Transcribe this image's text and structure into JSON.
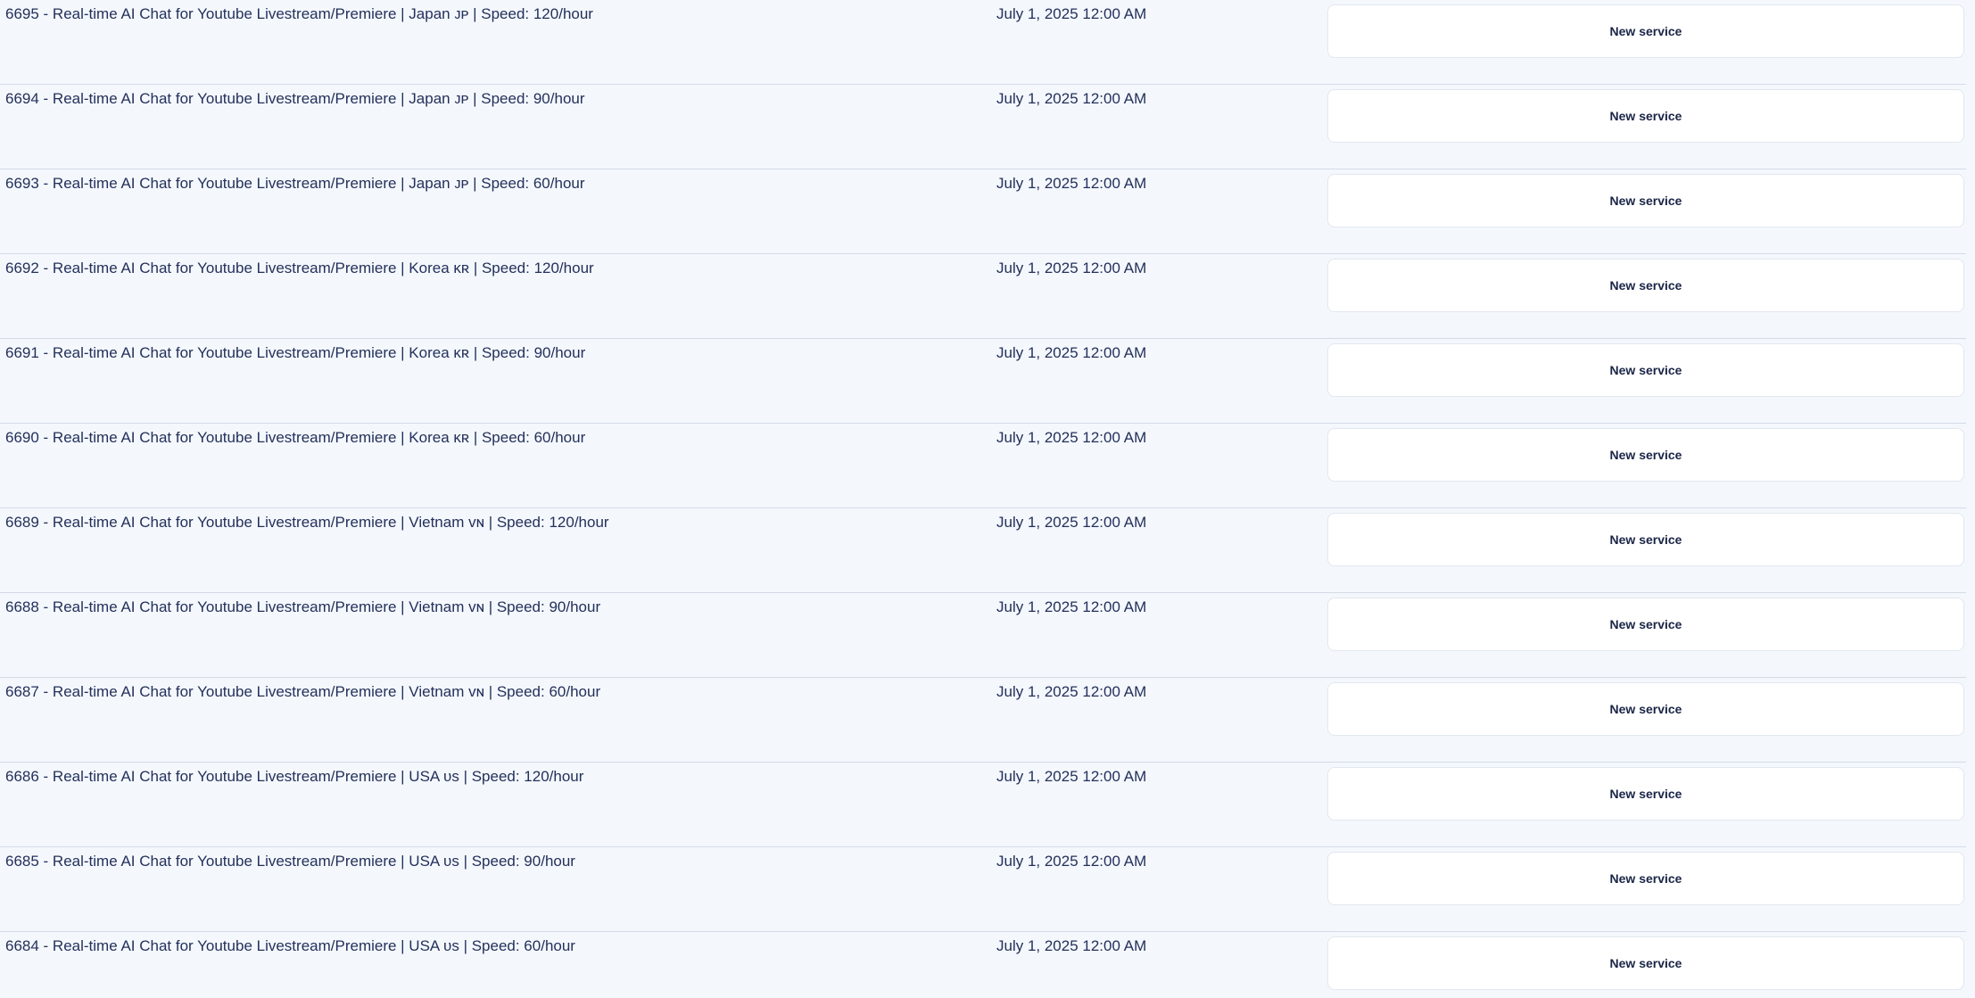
{
  "services": [
    {
      "name": "6695 - Real-time AI Chat for Youtube Livestream/Premiere | Japan ᴊᴘ | Speed: 120/hour",
      "date": "July 1, 2025 12:00 AM",
      "button": "New service"
    },
    {
      "name": "6694 - Real-time AI Chat for Youtube Livestream/Premiere | Japan ᴊᴘ | Speed: 90/hour",
      "date": "July 1, 2025 12:00 AM",
      "button": "New service"
    },
    {
      "name": "6693 - Real-time AI Chat for Youtube Livestream/Premiere | Japan ᴊᴘ | Speed: 60/hour",
      "date": "July 1, 2025 12:00 AM",
      "button": "New service"
    },
    {
      "name": "6692 - Real-time AI Chat for Youtube Livestream/Premiere | Korea ᴋʀ | Speed: 120/hour",
      "date": "July 1, 2025 12:00 AM",
      "button": "New service"
    },
    {
      "name": "6691 - Real-time AI Chat for Youtube Livestream/Premiere | Korea ᴋʀ | Speed: 90/hour",
      "date": "July 1, 2025 12:00 AM",
      "button": "New service"
    },
    {
      "name": "6690 - Real-time AI Chat for Youtube Livestream/Premiere | Korea ᴋʀ | Speed: 60/hour",
      "date": "July 1, 2025 12:00 AM",
      "button": "New service"
    },
    {
      "name": "6689 - Real-time AI Chat for Youtube Livestream/Premiere | Vietnam ᴠɴ | Speed: 120/hour",
      "date": "July 1, 2025 12:00 AM",
      "button": "New service"
    },
    {
      "name": "6688 - Real-time AI Chat for Youtube Livestream/Premiere | Vietnam ᴠɴ | Speed: 90/hour",
      "date": "July 1, 2025 12:00 AM",
      "button": "New service"
    },
    {
      "name": "6687 - Real-time AI Chat for Youtube Livestream/Premiere | Vietnam ᴠɴ | Speed: 60/hour",
      "date": "July 1, 2025 12:00 AM",
      "button": "New service"
    },
    {
      "name": "6686 - Real-time AI Chat for Youtube Livestream/Premiere | USA ᴜs | Speed: 120/hour",
      "date": "July 1, 2025 12:00 AM",
      "button": "New service"
    },
    {
      "name": "6685 - Real-time AI Chat for Youtube Livestream/Premiere | USA ᴜs | Speed: 90/hour",
      "date": "July 1, 2025 12:00 AM",
      "button": "New service"
    },
    {
      "name": "6684 - Real-time AI Chat for Youtube Livestream/Premiere | USA ᴜs | Speed: 60/hour",
      "date": "July 1, 2025 12:00 AM",
      "button": "New service"
    }
  ]
}
